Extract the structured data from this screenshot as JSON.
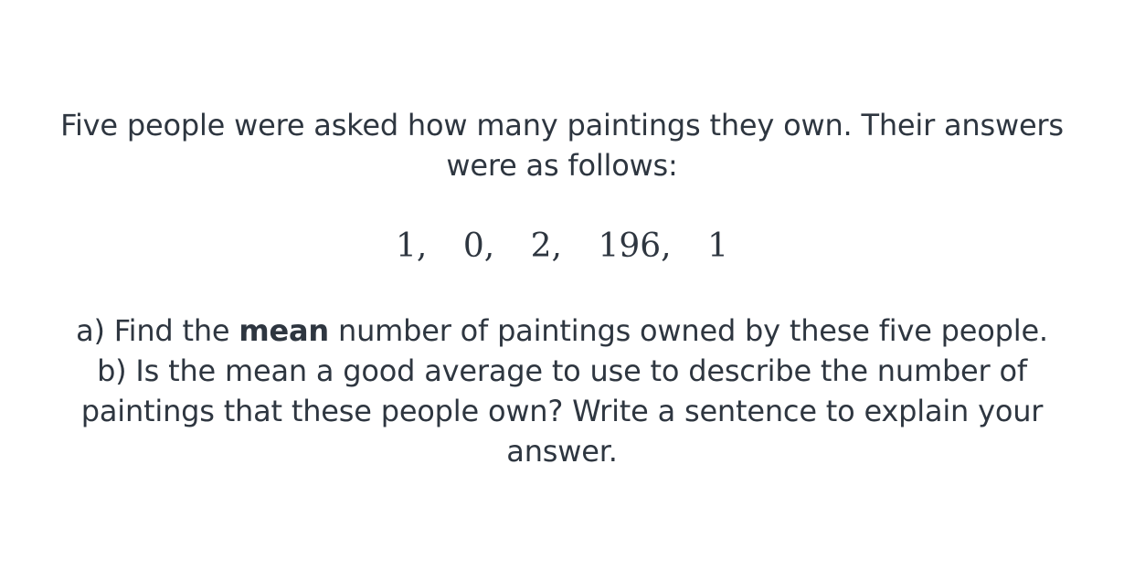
{
  "intro": {
    "text": "Five people were asked how many paintings they own. Their answers were as follows:"
  },
  "values": [
    "1,",
    "0,",
    "2,",
    "196,",
    "1"
  ],
  "question_a": {
    "before": "a) Find the ",
    "emphasis": "mean",
    "after": " number of paintings owned by these five people."
  },
  "question_b": {
    "text": "b) Is the mean a good average to use to describe the number of paintings that these people own? Write a sentence to explain your answer."
  }
}
